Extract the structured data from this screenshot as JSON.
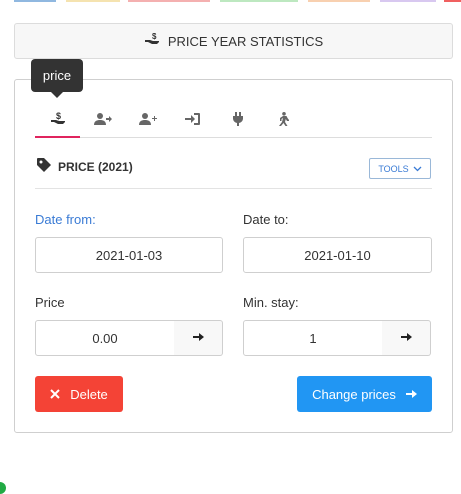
{
  "header": {
    "title": "PRICE YEAR STATISTICS",
    "icon": "hand-coin-icon"
  },
  "tooltip": {
    "text": "price"
  },
  "tabs": [
    {
      "name": "price",
      "icon": "hand-coin-icon",
      "active": true
    },
    {
      "name": "guests",
      "icon": "user-arrow-icon",
      "active": false
    },
    {
      "name": "add-guest",
      "icon": "user-plus-icon",
      "active": false
    },
    {
      "name": "check-in",
      "icon": "sign-in-icon",
      "active": false
    },
    {
      "name": "utilities",
      "icon": "plug-icon",
      "active": false
    },
    {
      "name": "walk",
      "icon": "walking-icon",
      "active": false
    }
  ],
  "section": {
    "title": "PRICE (2021)",
    "tools_label": "TOOLS"
  },
  "form": {
    "date_from_label": "Date from:",
    "date_from_value": "2021-01-03",
    "date_to_label": "Date to:",
    "date_to_value": "2021-01-10",
    "price_label": "Price",
    "price_value": "0.00",
    "min_stay_label": "Min. stay:",
    "min_stay_value": "1"
  },
  "buttons": {
    "delete_label": "Delete",
    "change_label": "Change prices"
  },
  "colors": {
    "accent_tab": "#e0245e",
    "delete": "#f44336",
    "primary": "#2196f3",
    "link": "#3a7bd5"
  }
}
